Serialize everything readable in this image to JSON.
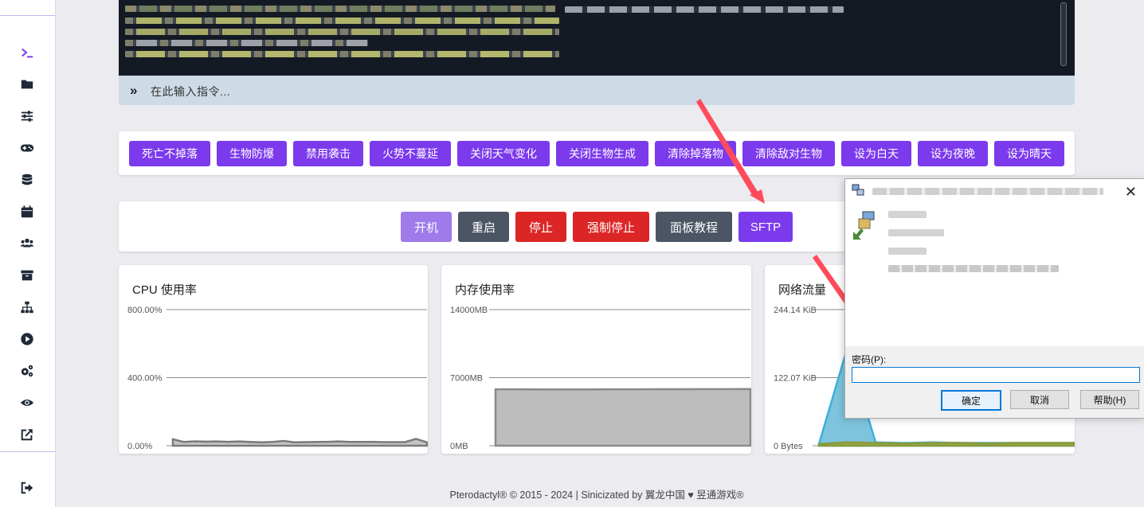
{
  "sidebar": {
    "icons": [
      "console-icon",
      "folder-icon",
      "sliders-icon",
      "gamepad-icon",
      "database-icon",
      "calendar-icon",
      "users-icon",
      "archive-icon",
      "network-icon",
      "play-icon",
      "cogs-icon",
      "eye-icon",
      "external-link-icon",
      "logout-icon"
    ]
  },
  "console": {
    "input_placeholder": "在此输入指令..."
  },
  "commands": [
    "死亡不掉落",
    "生物防爆",
    "禁用袭击",
    "火势不蔓延",
    "关闭天气变化",
    "关闭生物生成",
    "清除掉落物",
    "清除敌对生物",
    "设为白天",
    "设为夜晚",
    "设为晴天"
  ],
  "power": {
    "start": "开机",
    "restart": "重启",
    "stop": "停止",
    "kill": "强制停止",
    "tutorial": "面板教程",
    "sftp": "SFTP"
  },
  "colors": {
    "accent": "#7c3aed",
    "start": "#9f7aea",
    "restart": "#4b5563",
    "stop": "#dc2626",
    "tutorial": "#4b5563"
  },
  "charts": {
    "cpu": {
      "title": "CPU 使用率",
      "ticks": [
        "800.00%",
        "400.00%",
        "0.00%"
      ]
    },
    "memory": {
      "title": "内存使用率",
      "ticks": [
        "14000MB",
        "7000MB",
        "0MB"
      ]
    },
    "network": {
      "title": "网络流量",
      "ticks": [
        "244.14 KiB",
        "122.07 KiB",
        "0 Bytes"
      ]
    }
  },
  "chart_data": [
    {
      "type": "area",
      "title": "CPU 使用率",
      "ylim": [
        0,
        800
      ],
      "y_unit": "%",
      "values": [
        38,
        22,
        26,
        24,
        25,
        23,
        25,
        22,
        20,
        22,
        28,
        20,
        21,
        22,
        23,
        25,
        22,
        22,
        23,
        21,
        21,
        21,
        40,
        20
      ]
    },
    {
      "type": "area",
      "title": "内存使用率",
      "ylim": [
        0,
        14000
      ],
      "y_unit": "MB",
      "values": [
        5800,
        5800,
        5790,
        5790,
        5790,
        5800,
        5800,
        5810,
        5810,
        5820,
        5820,
        5830
      ]
    },
    {
      "type": "area",
      "title": "网络流量",
      "ylim": [
        0,
        244.14
      ],
      "y_unit": "KiB",
      "series": [
        {
          "values": [
            3,
            175,
            6,
            5,
            6,
            5,
            5,
            5,
            5,
            5
          ]
        },
        {
          "values": [
            3,
            6,
            5,
            4,
            5,
            5,
            4,
            5,
            5,
            5
          ]
        }
      ]
    }
  ],
  "dialog": {
    "password_label": "密码(P):",
    "password_value": "",
    "ok": "确定",
    "cancel": "取消",
    "help": "帮助(H)"
  },
  "footer": "Pterodactyl® © 2015 - 2024 | Sinicizated by 翼龙中国 ♥ 昱通游戏®"
}
